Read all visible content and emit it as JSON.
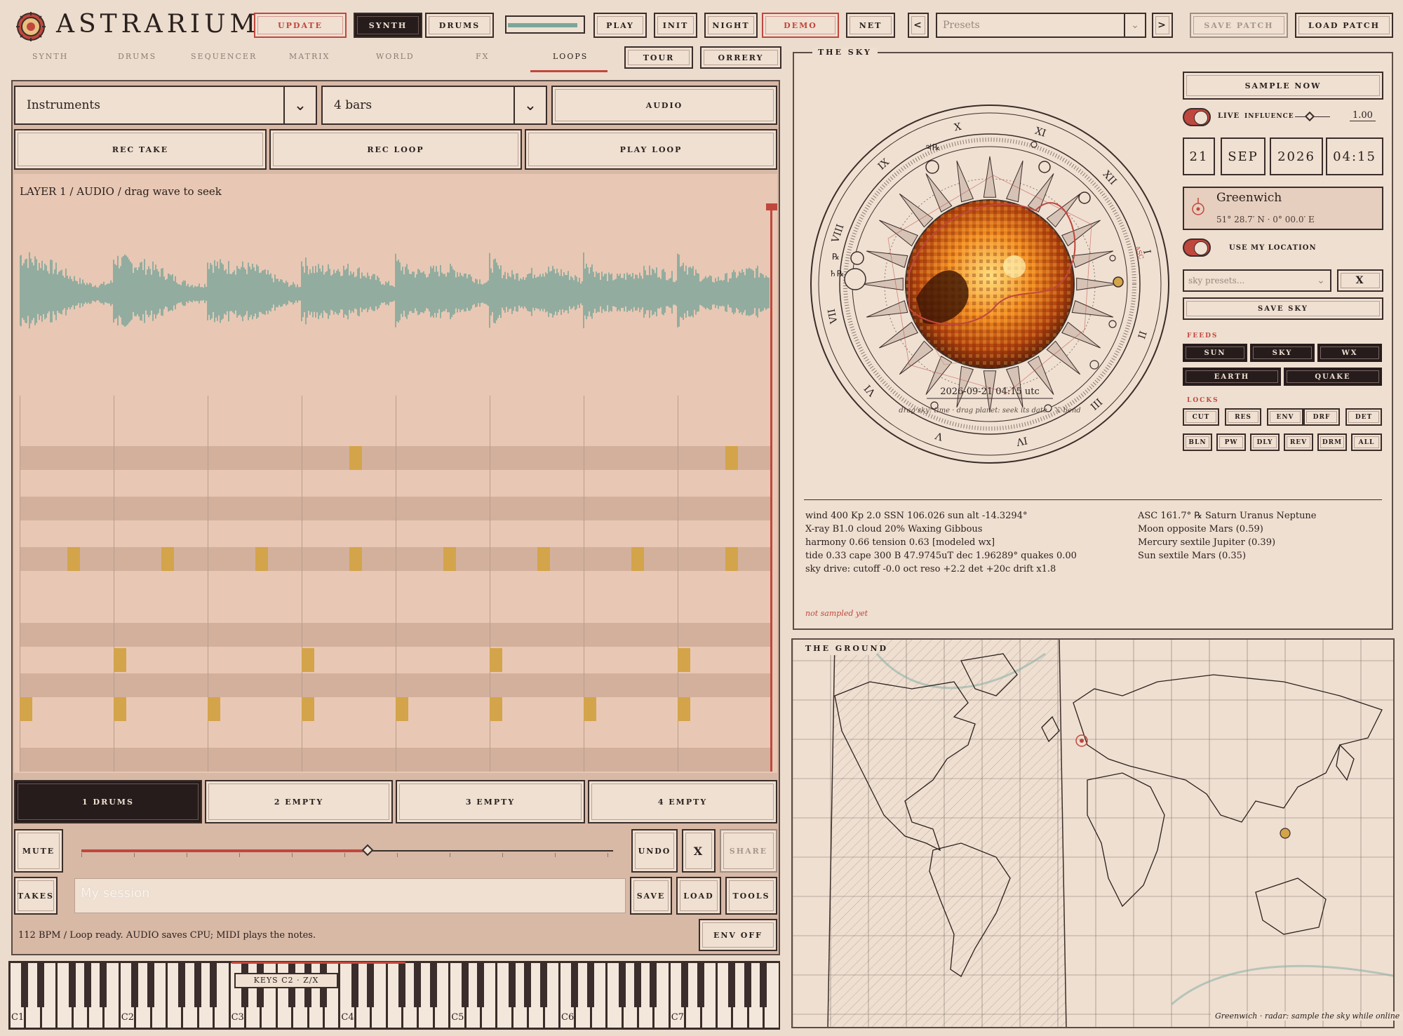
{
  "app": {
    "title": "ASTRARIUM"
  },
  "topbar": {
    "update": "UPDATE",
    "synth": "SYNTH",
    "drums": "DRUMS",
    "play": "PLAY",
    "init": "INIT",
    "night": "NIGHT",
    "demo": "DEMO",
    "net": "NET",
    "prev": "<",
    "next": ">",
    "presets_placeholder": "Presets",
    "save_patch": "SAVE PATCH",
    "load_patch": "LOAD PATCH",
    "level_meter": 0.9
  },
  "tabs": [
    "SYNTH",
    "DRUMS",
    "SEQUENCER",
    "MATRIX",
    "WORLD",
    "FX",
    "LOOPS"
  ],
  "active_tab": "LOOPS",
  "tour": "TOUR",
  "orrery": "ORRERY",
  "loops": {
    "instrument_select": "Instruments",
    "bars_select": "4 bars",
    "audio": "AUDIO",
    "rec_take": "REC TAKE",
    "rec_loop": "REC LOOP",
    "play_loop": "PLAY LOOP",
    "layer_label": "LAYER 1 / AUDIO / drag wave to seek",
    "slots": [
      "1 DRUMS",
      "2 EMPTY",
      "3 EMPTY",
      "4 EMPTY"
    ],
    "mute": "MUTE",
    "undo": "UNDO",
    "clear": "X",
    "share": "SHARE",
    "takes": "TAKES",
    "session_name": "My session",
    "save": "SAVE",
    "load": "LOAD",
    "tools": "TOOLS",
    "status": "112 BPM / Loop ready. AUDIO saves CPU; MIDI plays the notes.",
    "env_off": "ENV OFF",
    "slider_position": 0.54,
    "keys_label": "KEYS C2 · Z/X",
    "octave_labels": [
      "C1",
      "C2",
      "C3",
      "C4",
      "C5",
      "C6",
      "C7"
    ]
  },
  "sky": {
    "title": "THE SKY",
    "sample_now": "SAMPLE NOW",
    "live_label": "LIVE",
    "influence_label": "INFLUENCE",
    "influence_value": "1.00",
    "date": {
      "day": "21",
      "month": "SEP",
      "year": "2026",
      "time": "04:15"
    },
    "location_name": "Greenwich",
    "location_coords": "51° 28.7′ N · 0° 00.0′ E",
    "use_my_location": "USE MY LOCATION",
    "sky_presets_placeholder": "sky presets...",
    "clear": "X",
    "save_sky": "SAVE SKY",
    "feeds_label": "FEEDS",
    "feeds": [
      "SUN",
      "SKY",
      "WX",
      "EARTH",
      "QUAKE"
    ],
    "locks_label": "LOCKS",
    "locks_row1": [
      "CUT",
      "RES",
      "ENV",
      "DRF",
      "DET"
    ],
    "locks_row2": [
      "BLN",
      "PW",
      "DLY",
      "REV",
      "DRM",
      "ALL"
    ],
    "chart_timestamp": "2026-09-21 04:15 utc",
    "chart_hint": "drag sky: time · drag planet: seek its date · ⌥ bend",
    "roman": [
      "X",
      "XI",
      "XII",
      "I",
      "II",
      "III",
      "IV",
      "V",
      "VI",
      "VII",
      "VIII",
      "IX"
    ],
    "retro_marks": [
      "♃℞",
      "℞",
      "♄℞"
    ],
    "data_left": [
      "wind 400  Kp 2.0  SSN 106.026  sun alt -14.3294°",
      "X-ray B1.0  cloud 20%  Waxing Gibbous",
      "harmony 0.66  tension 0.63  [modeled wx]",
      "tide 0.33  cape 300  B 47.9745uT  dec 1.96289°  quakes 0.00",
      "sky drive:  cutoff -0.0 oct   reso +2.2   det +20c   drift x1.8"
    ],
    "data_right": [
      "ASC 161.7°  ℞ Saturn Uranus Neptune",
      "Moon opposite Mars  (0.59)",
      "Mercury sextile Jupiter  (0.39)",
      "Sun sextile Mars  (0.35)"
    ],
    "status": "not sampled yet"
  },
  "ground": {
    "title": "THE GROUND",
    "caption": "Greenwich · radar: sample the sky while online"
  },
  "colors": {
    "accent": "#c0473d",
    "wave": "#7ca69a",
    "cell": "#d4a44b",
    "dark": "#271c1c",
    "paper": "#ecdccd"
  },
  "icons": [
    "astrarium-logo-icon",
    "chevron-down-icon",
    "location-pin-icon"
  ]
}
